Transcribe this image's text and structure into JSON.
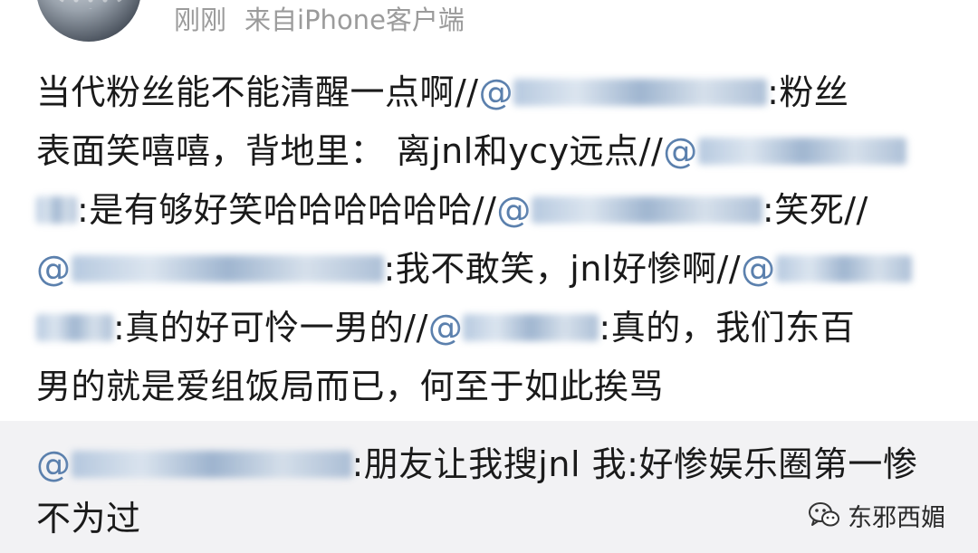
{
  "header": {
    "time": "刚刚",
    "source": "来自iPhone客户端"
  },
  "post": {
    "s1": "当代粉丝能不能清醒一点啊//",
    "m1": "@",
    "s2": ":粉丝",
    "s3": "表面笑嘻嘻，背地里：  离jnl和ycy远点//",
    "m2": "@",
    "s4": ":是有够好笑哈哈哈哈哈哈//",
    "m3": "@",
    "s5": ":笑死//",
    "m4": "@",
    "s6": ":我不敢笑，jnl好惨啊//",
    "m5": "@",
    "s7": ":真的好可怜一男的//",
    "m6": "@",
    "s8": ":真的，我们东百",
    "s9": "男的就是爱组饭局而已，何至于如此挨骂"
  },
  "repost": {
    "m1": "@",
    "t1": ":朋友让我搜jnl 我:好惨娱乐圈第一惨",
    "t2": "不为过"
  },
  "watermark": {
    "icon": "wechat-icon",
    "text": "东邪西媚"
  },
  "colors": {
    "mention": "#5b80ad",
    "meta": "#9b9b9b",
    "repost_bg": "#f2f2f4"
  }
}
